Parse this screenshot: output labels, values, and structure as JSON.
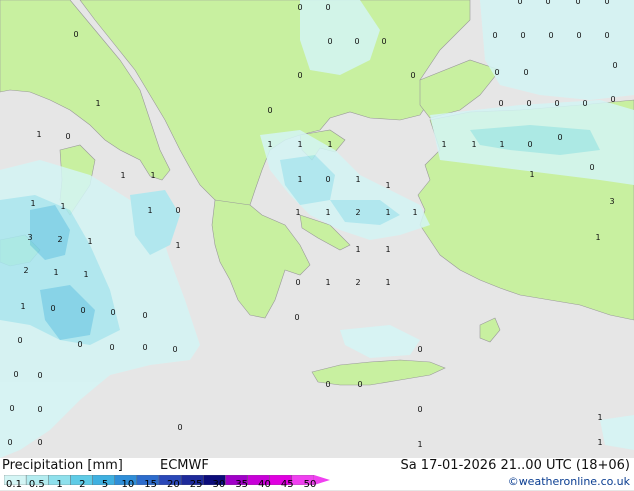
{
  "footer": {
    "title": "Precipitation [mm]",
    "model": "ECMWF",
    "datetime": "Sa 17-01-2026 21..00 UTC (18+06)",
    "credit": "©weatheronline.co.uk"
  },
  "legend": {
    "ticks": [
      "0.1",
      "0.5",
      "1",
      "2",
      "5",
      "10",
      "15",
      "20",
      "25",
      "30",
      "35",
      "40",
      "45",
      "50"
    ],
    "colors": [
      "#d4f5f5",
      "#b4ecf0",
      "#8fe0ec",
      "#5fcbe6",
      "#3fb0e0",
      "#2f8ed8",
      "#2d6ccc",
      "#2a48b8",
      "#1e2a9a",
      "#0c0c7a",
      "#a000c8",
      "#c800d8",
      "#e000e0",
      "#f040f0"
    ]
  },
  "map_colors": {
    "sea": "#e6e6e6",
    "land": "#c8f0a0",
    "rain_light": "#d4f5f5",
    "rain_mid": "#a8e8f0",
    "rain_heavy": "#78d0e8"
  },
  "values": [
    "0",
    "0",
    "0",
    "0",
    "0",
    "0",
    "0",
    "0",
    "0",
    "0",
    "0",
    "0",
    "0",
    "0",
    "0",
    "0",
    "0",
    "0",
    "0",
    "0",
    "1",
    "0",
    "0",
    "0",
    "0",
    "0",
    "0",
    "1",
    "1",
    "1",
    "1",
    "1",
    "1",
    "0",
    "0",
    "0",
    "1",
    "0",
    "1",
    "1",
    "1",
    "0",
    "1",
    "1",
    "1",
    "1",
    "1",
    "1",
    "0",
    "1",
    "1",
    "2",
    "1",
    "1",
    "3",
    "3",
    "2",
    "1",
    "1",
    "1",
    "1",
    "1",
    "2",
    "1",
    "1",
    "0",
    "1",
    "2",
    "1",
    "1",
    "0",
    "0",
    "0",
    "0",
    "0",
    "0",
    "0",
    "0",
    "0",
    "0",
    "0",
    "0",
    "0",
    "0",
    "0",
    "0",
    "0",
    "0",
    "1",
    "0",
    "0",
    "1",
    "1",
    "0",
    "0"
  ]
}
